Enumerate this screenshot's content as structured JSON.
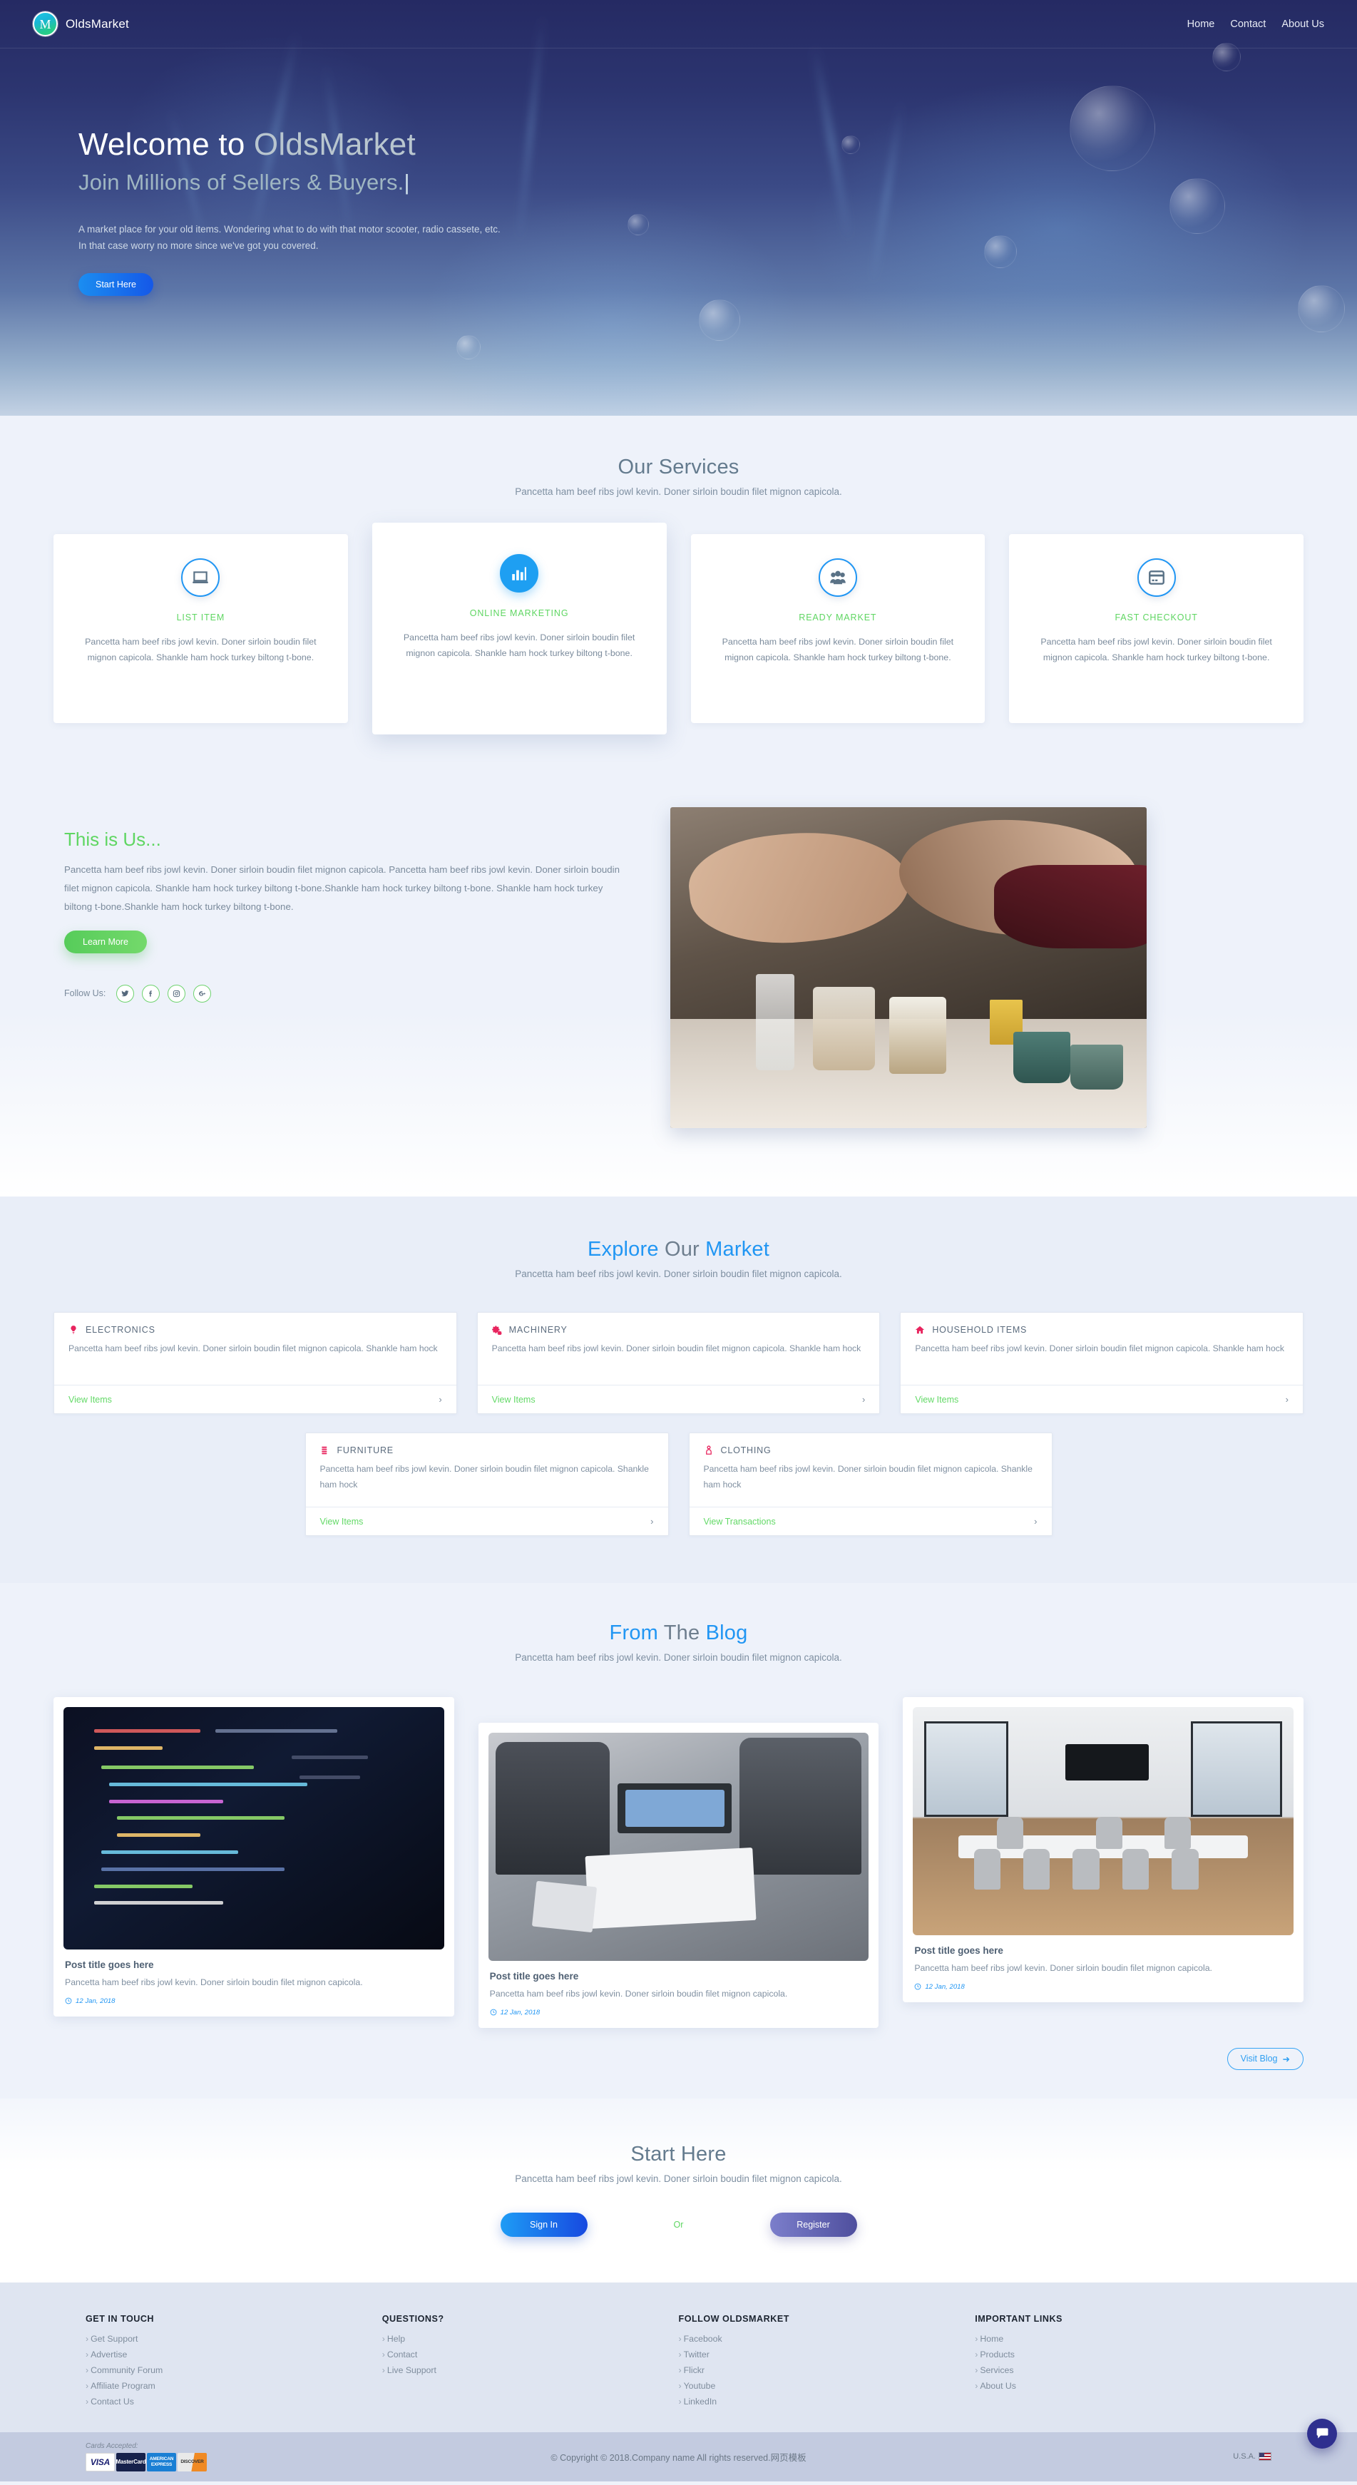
{
  "header": {
    "brand_initial": "M",
    "brand_name": "OldsMarket",
    "nav": [
      {
        "label": "Home"
      },
      {
        "label": "Contact"
      },
      {
        "label": "About Us"
      }
    ]
  },
  "hero": {
    "title_main": "Welcome to ",
    "title_alt": "OldsMarket",
    "subtitle": "Join Millions of Sellers & Buyers.",
    "caret": "|",
    "paragraph_line1": "A market place for your old items. Wondering what to do with that motor scooter, radio cassete, etc.",
    "paragraph_line2": "In that case worry no more since we've got you covered.",
    "cta_label": "Start Here"
  },
  "services": {
    "title": "Our Services",
    "subtitle": "Pancetta ham beef ribs jowl kevin. Doner sirloin boudin filet mignon capicola.",
    "cards": [
      {
        "icon": "laptop-icon",
        "name": "LIST ITEM",
        "text": "Pancetta ham beef ribs jowl kevin. Doner sirloin boudin filet mignon capicola. Shankle ham hock turkey biltong t-bone."
      },
      {
        "icon": "bar-chart-icon",
        "name": "ONLINE MARKETING",
        "text": "Pancetta ham beef ribs jowl kevin. Doner sirloin boudin filet mignon capicola. Shankle ham hock turkey biltong t-bone."
      },
      {
        "icon": "users-group-icon",
        "name": "READY MARKET",
        "text": "Pancetta ham beef ribs jowl kevin. Doner sirloin boudin filet mignon capicola. Shankle ham hock turkey biltong t-bone."
      },
      {
        "icon": "credit-card-icon",
        "name": "FAST CHECKOUT",
        "text": "Pancetta ham beef ribs jowl kevin. Doner sirloin boudin filet mignon capicola. Shankle ham hock turkey biltong t-bone."
      }
    ]
  },
  "about": {
    "heading": "This is Us...",
    "paragraph": "Pancetta ham beef ribs jowl kevin. Doner sirloin boudin filet mignon capicola. Pancetta ham beef ribs jowl kevin. Doner sirloin boudin filet mignon capicola. Shankle ham hock turkey biltong t-bone.Shankle ham hock turkey biltong t-bone. Shankle ham hock turkey biltong t-bone.Shankle ham hock turkey biltong t-bone.",
    "cta_label": "Learn More",
    "follow_label": "Follow Us:",
    "socials": [
      {
        "icon": "twitter-icon"
      },
      {
        "icon": "facebook-icon"
      },
      {
        "icon": "instagram-icon"
      },
      {
        "icon": "google-plus-icon"
      }
    ],
    "image_alt": "handshake-over-desk-photo"
  },
  "market": {
    "title_a": "Explore ",
    "title_b": "Our ",
    "title_c": "Market",
    "subtitle": "Pancetta ham beef ribs jowl kevin. Doner sirloin boudin filet mignon capicola.",
    "row1": [
      {
        "icon": "lightbulb-icon",
        "title": "ELECTRONICS",
        "text": "Pancetta ham beef ribs jowl kevin. Doner sirloin boudin filet mignon capicola. Shankle ham hock",
        "link": "View Items",
        "chevron": "›"
      },
      {
        "icon": "gears-icon",
        "title": "MACHINERY",
        "text": "Pancetta ham beef ribs jowl kevin. Doner sirloin boudin filet mignon capicola. Shankle ham hock",
        "link": "View Items",
        "chevron": "›"
      },
      {
        "icon": "home-icon",
        "title": "HOUSEHOLD ITEMS",
        "text": "Pancetta ham beef ribs jowl kevin. Doner sirloin boudin filet mignon capicola. Shankle ham hock",
        "link": "View Items",
        "chevron": "›"
      }
    ],
    "row2": [
      {
        "icon": "furniture-stack-icon",
        "title": "FURNITURE",
        "text": "Pancetta ham beef ribs jowl kevin. Doner sirloin boudin filet mignon capicola. Shankle ham hock",
        "link": "View Items",
        "chevron": "›"
      },
      {
        "icon": "tshirt-icon",
        "title": "CLOTHING",
        "text": "Pancetta ham beef ribs jowl kevin. Doner sirloin boudin filet mignon capicola. Shankle ham hock",
        "link": "View Transactions",
        "chevron": "›"
      }
    ]
  },
  "blog": {
    "title_a": "From ",
    "title_b": "The ",
    "title_c": "Blog",
    "subtitle": "Pancetta ham beef ribs jowl kevin. Doner sirloin boudin filet mignon capicola.",
    "posts": [
      {
        "image": "code-editor-screen-photo",
        "title": "Post title goes here",
        "text": "Pancetta ham beef ribs jowl kevin. Doner sirloin boudin filet mignon capicola.",
        "date": "12 Jan, 2018"
      },
      {
        "image": "team-meeting-photo",
        "title": "Post title goes here",
        "text": "Pancetta ham beef ribs jowl kevin. Doner sirloin boudin filet mignon capicola.",
        "date": "12 Jan, 2018"
      },
      {
        "image": "empty-conference-room-photo",
        "title": "Post title goes here",
        "text": "Pancetta ham beef ribs jowl kevin. Doner sirloin boudin filet mignon capicola.",
        "date": "12 Jan, 2018"
      }
    ],
    "visit_label": "Visit Blog",
    "visit_arrow": "➜"
  },
  "start": {
    "title": "Start Here",
    "subtitle": "Pancetta ham beef ribs jowl kevin. Doner sirloin boudin filet mignon capicola.",
    "signin_label": "Sign In",
    "or_label": "Or",
    "register_label": "Register"
  },
  "footer": {
    "columns": [
      {
        "heading": "GET IN TOUCH",
        "links": [
          "Get Support",
          "Advertise",
          "Community Forum",
          "Affiliate Program",
          "Contact Us"
        ]
      },
      {
        "heading": "QUESTIONS?",
        "links": [
          "Help",
          "Contact",
          "Live Support"
        ]
      },
      {
        "heading": "FOLLOW OLDSMARKET",
        "links": [
          "Facebook",
          "Twitter",
          "Flickr",
          "Youtube",
          "LinkedIn"
        ]
      },
      {
        "heading": "IMPORTANT LINKS",
        "links": [
          "Home",
          "Products",
          "Services",
          "About Us"
        ]
      }
    ],
    "bar": {
      "cards_label": "Cards Accepted:",
      "cards": [
        {
          "name": "visa-card-icon",
          "text": "VISA"
        },
        {
          "name": "mastercard-card-icon",
          "text": "MasterCard"
        },
        {
          "name": "amex-card-icon",
          "text": "AMERICAN EXPRESS"
        },
        {
          "name": "discover-card-icon",
          "text": "DISCOVER"
        }
      ],
      "copyright": "© Copyright © 2018.Company name All rights reserved.网页模板",
      "region": "U.S.A."
    }
  },
  "chat": {
    "icon": "chat-bubble-icon"
  },
  "colors": {
    "accent_blue": "#2196f3",
    "accent_green": "#5fd662",
    "accent_pink": "#e8245e",
    "footer_bg": "#dfe5f1",
    "footbar_bg": "#c3cbe0",
    "chat_bg": "#2e2f8f"
  }
}
